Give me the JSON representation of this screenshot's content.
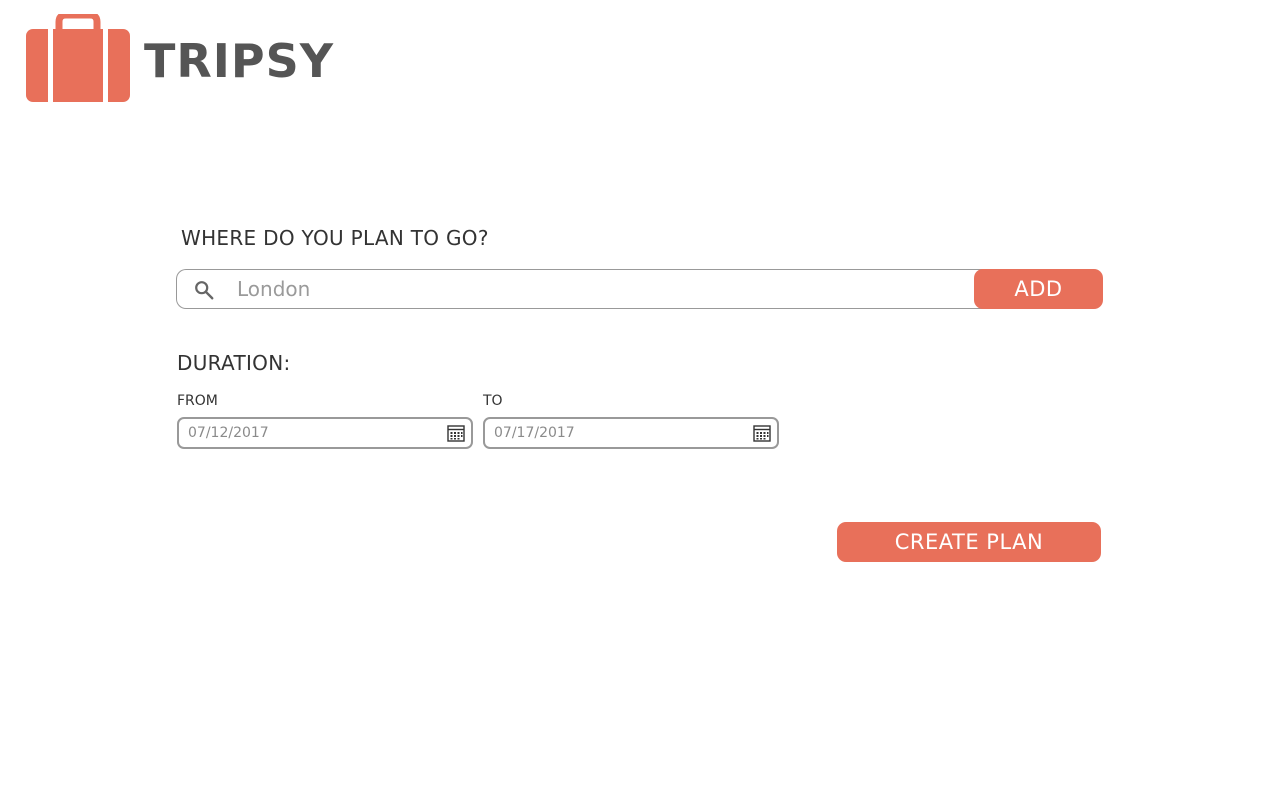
{
  "brand": {
    "name": "TRIPSY",
    "accent_color": "#e8705a",
    "text_color": "#555555",
    "logo_icon": "suitcase-icon"
  },
  "destination": {
    "title": "WHERE DO YOU PLAN TO GO?",
    "search_icon": "search-icon",
    "search_placeholder": "London",
    "search_value": "",
    "add_label": "ADD"
  },
  "duration": {
    "title": "DURATION:",
    "from_label": "FROM",
    "from_value": "07/12/2017",
    "to_label": "TO",
    "to_value": "07/17/2017",
    "calendar_icon": "calendar-icon"
  },
  "actions": {
    "create_label": "CREATE PLAN"
  }
}
